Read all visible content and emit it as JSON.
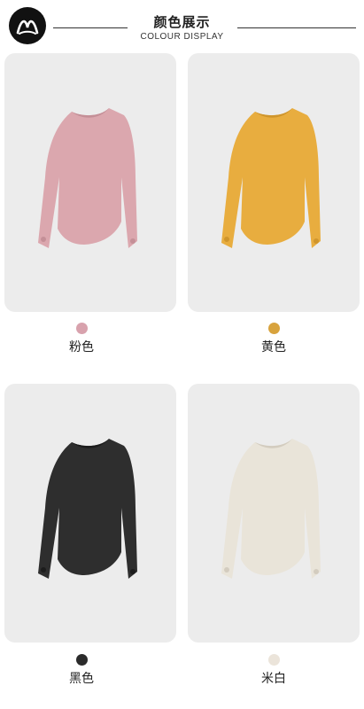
{
  "header": {
    "title": "颜色展示",
    "subtitle": "COLOUR DISPLAY"
  },
  "colors": [
    {
      "label": "粉色",
      "swatch": "#d8a2ad",
      "garment": "#dba7ae",
      "garment_dark": "#c48f97"
    },
    {
      "label": "黄色",
      "swatch": "#d8a33d",
      "garment": "#e8ad3f",
      "garment_dark": "#cf952c"
    },
    {
      "label": "黑色",
      "swatch": "#2b2b2b",
      "garment": "#2e2e2e",
      "garment_dark": "#1c1c1c"
    },
    {
      "label": "米白",
      "swatch": "#ebe4da",
      "garment": "#e9e4d9",
      "garment_dark": "#d3ccbf"
    }
  ]
}
